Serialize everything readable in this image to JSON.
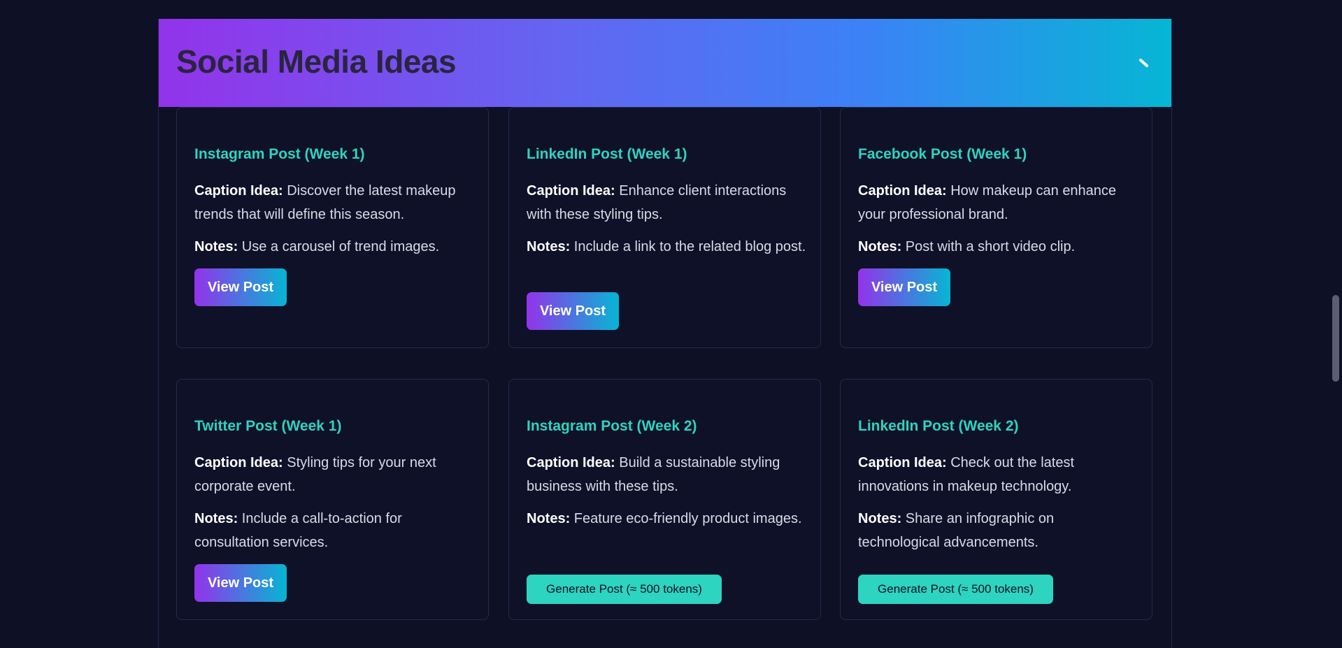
{
  "header": {
    "title": "Social Media Ideas"
  },
  "labels": {
    "caption": "Caption Idea:",
    "notes": "Notes:"
  },
  "cards": [
    {
      "title": "Instagram Post (Week 1)",
      "caption": "Discover the latest makeup trends that will define this season.",
      "notes": "Use a carousel of trend images.",
      "button": "View Post"
    },
    {
      "title": "LinkedIn Post (Week 1)",
      "caption": "Enhance client interactions with these styling tips.",
      "notes": "Include a link to the related blog post.",
      "button": "View Post"
    },
    {
      "title": "Facebook Post (Week 1)",
      "caption": "How makeup can enhance your professional brand.",
      "notes": "Post with a short video clip.",
      "button": "View Post"
    },
    {
      "title": "Twitter Post (Week 1)",
      "caption": "Styling tips for your next corporate event.",
      "notes": "Include a call-to-action for consultation services.",
      "button": "View Post"
    },
    {
      "title": "Instagram Post (Week 2)",
      "caption": "Build a sustainable styling business with these tips.",
      "notes": "Feature eco-friendly product images.",
      "button": "Generate Post (≈ 500 tokens)"
    },
    {
      "title": "LinkedIn Post (Week 2)",
      "caption": "Check out the latest innovations in makeup technology.",
      "notes": "Share an infographic on technological advancements.",
      "button": "Generate Post (≈ 500 tokens)"
    }
  ],
  "icons": {
    "header_toggle": "collapse-icon"
  },
  "colors": {
    "background": "#0e1026",
    "accent": "#2dd4bf",
    "gradient_start": "#9333ea",
    "gradient_end": "#06b6d4"
  }
}
